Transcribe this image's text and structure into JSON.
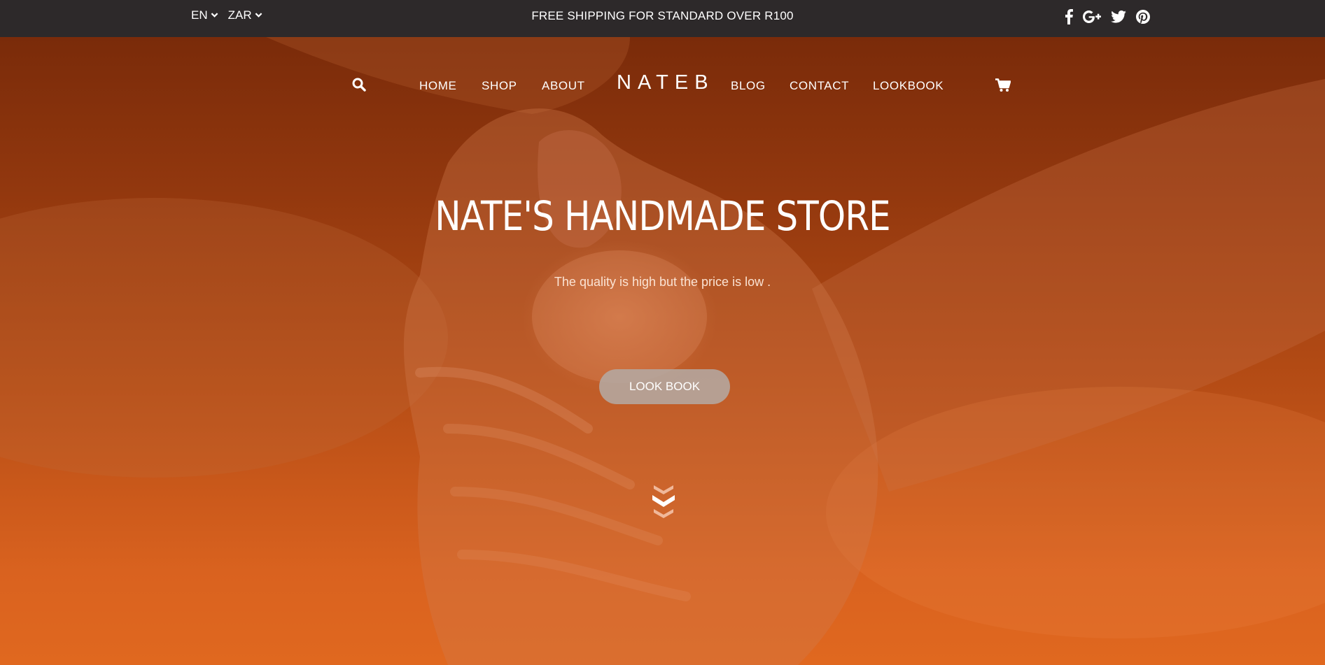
{
  "topbar": {
    "language": "EN",
    "currency": "ZAR",
    "shipping_notice": "FREE SHIPPING FOR STANDARD OVER R100",
    "social_icons": [
      "facebook-icon",
      "google-plus-icon",
      "twitter-icon",
      "pinterest-icon"
    ]
  },
  "nav": {
    "logo": "NATEB",
    "left_items": [
      "HOME",
      "SHOP",
      "ABOUT"
    ],
    "right_items": [
      "BLOG",
      "CONTACT",
      "LOOKBOOK"
    ],
    "icons": [
      "search-icon",
      "cart-icon"
    ]
  },
  "hero": {
    "title": "NATE'S HANDMADE STORE",
    "subtitle": "The quality is high but the price is low .",
    "button_label": "LOOK BOOK",
    "scroll_icon": "chevron-double-down-icon"
  },
  "colors": {
    "topbar_bg": "#2d292a",
    "hero_overlay_top": "#7a2b0a",
    "hero_overlay_bottom": "#e0681f",
    "button_bg": "#b4aaa5",
    "text": "#ffffff"
  }
}
